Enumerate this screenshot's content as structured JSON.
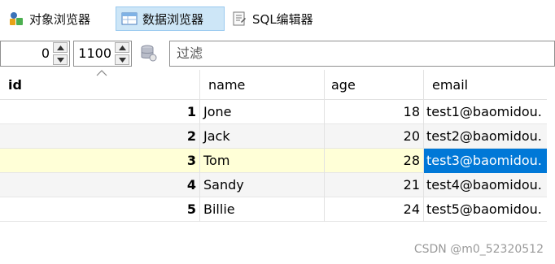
{
  "toolbar": {
    "items": [
      {
        "label": "对象浏览器",
        "icon": "object-browser-icon"
      },
      {
        "label": "数据浏览器",
        "icon": "data-browser-icon",
        "active": true
      },
      {
        "label": "SQL编辑器",
        "icon": "sql-editor-icon"
      }
    ]
  },
  "navigator": {
    "offset": "0",
    "limit": "1100",
    "filter_placeholder": "过滤",
    "db_icon": "database-icon"
  },
  "grid": {
    "columns": [
      "id",
      "name",
      "age",
      "email"
    ],
    "sorted_column": "id",
    "rows": [
      {
        "id": "1",
        "name": "Jone",
        "age": "18",
        "email": "test1@baomidou."
      },
      {
        "id": "2",
        "name": "Jack",
        "age": "20",
        "email": "test2@baomidou."
      },
      {
        "id": "3",
        "name": "Tom",
        "age": "28",
        "email": "test3@baomidou."
      },
      {
        "id": "4",
        "name": "Sandy",
        "age": "21",
        "email": "test4@baomidou."
      },
      {
        "id": "5",
        "name": "Billie",
        "age": "24",
        "email": "test5@baomidou."
      }
    ],
    "selected_row": 2
  },
  "watermark": "CSDN @m0_52320512",
  "colors": {
    "selected_row": "#ffffd7",
    "selected_cell": "#0078d7",
    "active_button": "#cde6f7"
  }
}
